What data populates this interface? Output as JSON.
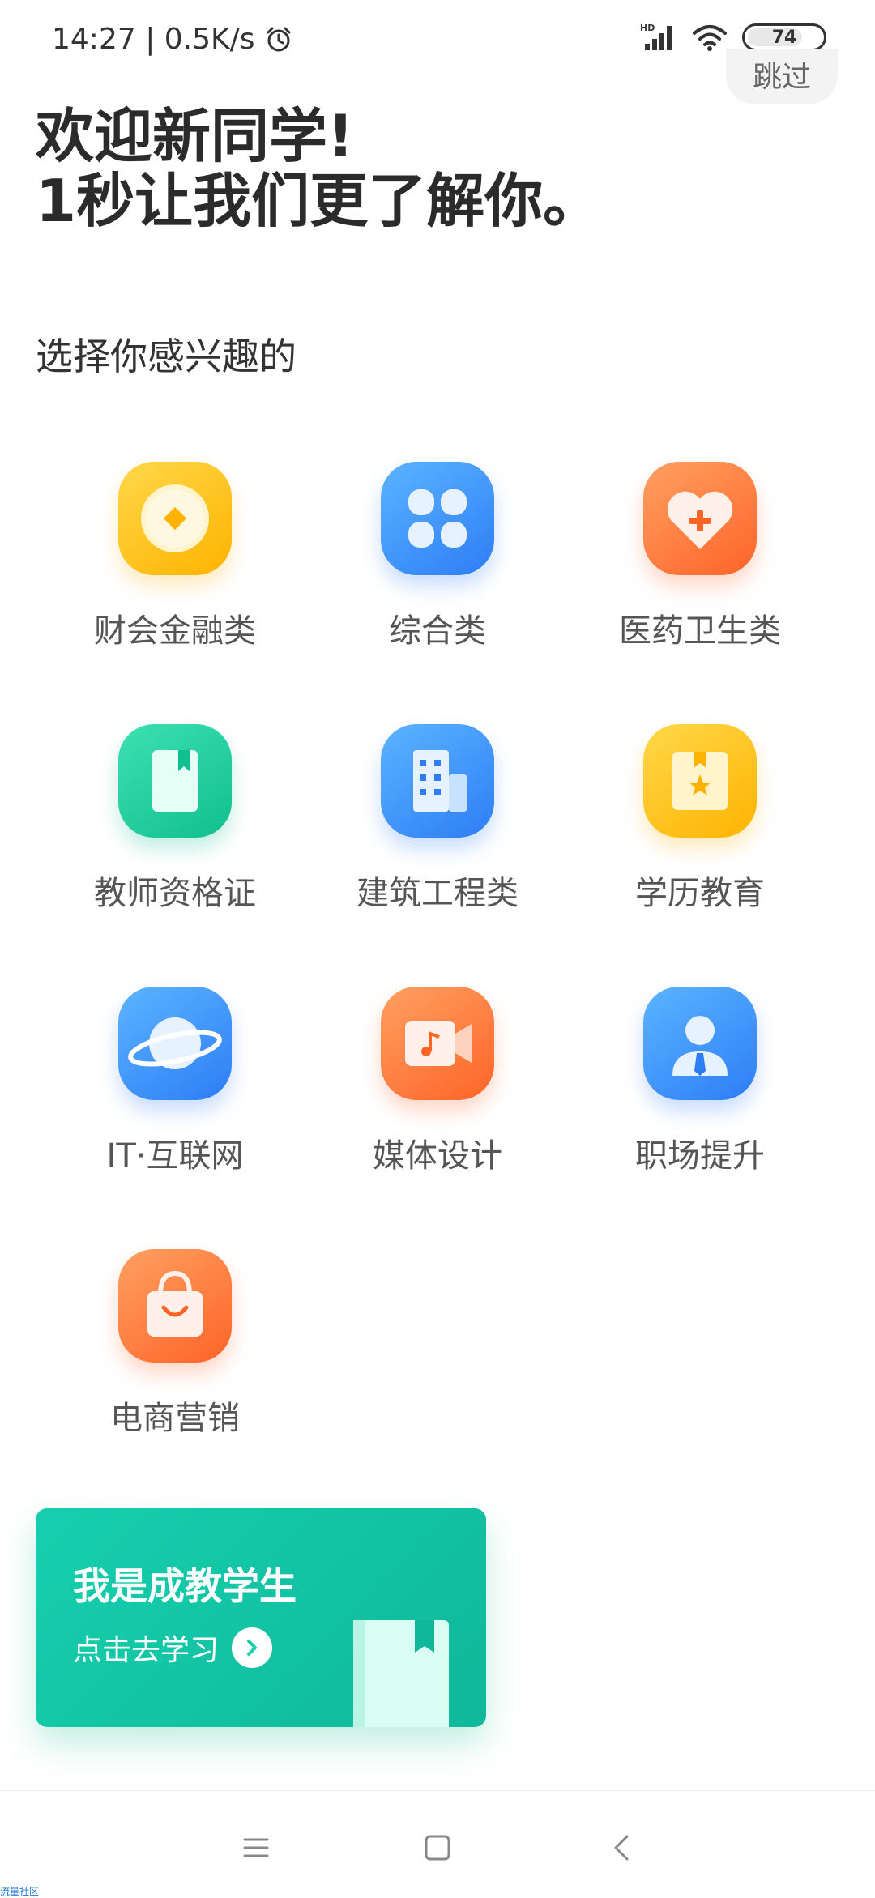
{
  "status_bar": {
    "time_speed": "14:27 | 0.5K/s",
    "signal_label": "HD",
    "battery": "74",
    "battery_level": 0.74
  },
  "header": {
    "skip": "跳过",
    "welcome_line1": "欢迎新同学!",
    "welcome_line2": "1秒让我们更了解你。",
    "subtitle": "选择你感兴趣的"
  },
  "categories": [
    {
      "label": "财会金融类",
      "icon": "coin-icon",
      "color": "#ffb300"
    },
    {
      "label": "综合类",
      "icon": "clover-icon",
      "color": "#2e7df6"
    },
    {
      "label": "医药卫生类",
      "icon": "medical-heart-icon",
      "color": "#ff6427"
    },
    {
      "label": "教师资格证",
      "icon": "book-bookmark-icon",
      "color": "#10bf8f"
    },
    {
      "label": "建筑工程类",
      "icon": "building-icon",
      "color": "#2e7df6"
    },
    {
      "label": "学历教育",
      "icon": "certificate-star-icon",
      "color": "#ffb300"
    },
    {
      "label": "IT·互联网",
      "icon": "planet-icon",
      "color": "#2e7df6"
    },
    {
      "label": "媒体设计",
      "icon": "video-camera-icon",
      "color": "#ff6427"
    },
    {
      "label": "职场提升",
      "icon": "professional-person-icon",
      "color": "#2e7df6"
    },
    {
      "label": "电商营销",
      "icon": "shopping-bag-icon",
      "color": "#ff6427"
    }
  ],
  "promo": {
    "title": "我是成教学生",
    "link": "点击去学习",
    "color": "#16cfae"
  },
  "footer": {
    "caption": "流量社区"
  }
}
